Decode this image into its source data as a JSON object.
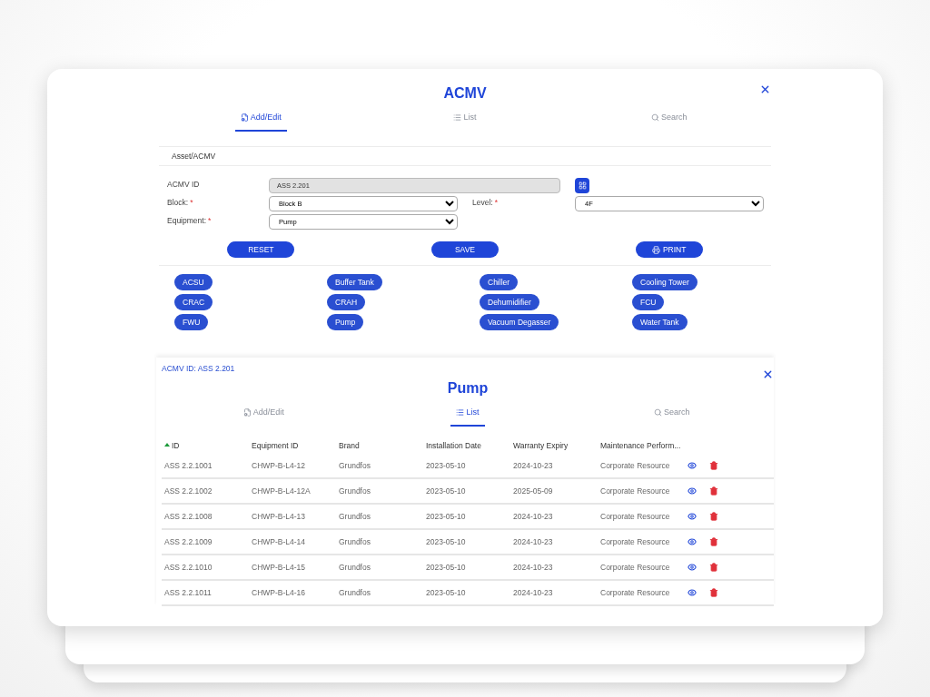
{
  "dialog": {
    "title": "ACMV",
    "tabs": [
      {
        "label": "Add/Edit",
        "kind": "add_edit",
        "selected": true
      },
      {
        "label": "List",
        "kind": "list",
        "selected": false
      },
      {
        "label": "Search",
        "kind": "search",
        "selected": false
      }
    ],
    "breadcrumb": "Asset/ACMV",
    "form": {
      "acmv_id": {
        "label": "ACMV ID",
        "value": "ASS 2.201",
        "disabled": true
      },
      "block": {
        "label": "Block:",
        "required_mark": "*",
        "value": "Block B"
      },
      "level": {
        "label": "Level:",
        "required_mark": "*",
        "value": "4F"
      },
      "equipment": {
        "label": "Equipment:",
        "required_mark": "*",
        "value": "Pump"
      }
    },
    "buttons": [
      {
        "label": "RESET",
        "kind": "plain"
      },
      {
        "label": "SAVE",
        "kind": "plain"
      },
      {
        "label": "PRINT",
        "kind": "print"
      }
    ],
    "equipment_types": [
      "ACSU",
      "Buffer Tank",
      "Chiller",
      "Cooling Tower",
      "CRAC",
      "CRAH",
      "Dehumidifier",
      "FCU",
      "FWU",
      "Pump",
      "Vacuum Degasser",
      "Water Tank"
    ]
  },
  "list_panel": {
    "context": "ACMV ID: ASS 2.201",
    "title": "Pump",
    "tabs": [
      {
        "label": "Add/Edit",
        "kind": "add_edit",
        "selected": false
      },
      {
        "label": "List",
        "kind": "list",
        "selected": true
      },
      {
        "label": "Search",
        "kind": "search",
        "selected": false
      }
    ],
    "table": {
      "columns": [
        {
          "label": "ID",
          "sorted": true
        },
        {
          "label": "Equipment ID",
          "sorted": false
        },
        {
          "label": "Brand",
          "sorted": false
        },
        {
          "label": "Installation Date",
          "sorted": false
        },
        {
          "label": "Warranty Expiry",
          "sorted": false
        },
        {
          "label": "Maintenance Perform...",
          "sorted": false
        }
      ],
      "rows": [
        [
          "ASS 2.2.1001",
          "CHWP-B-L4-12",
          "Grundfos",
          "2023-05-10",
          "2024-10-23",
          "Corporate Resource"
        ],
        [
          "ASS 2.2.1002",
          "CHWP-B-L4-12A",
          "Grundfos",
          "2023-05-10",
          "2025-05-09",
          "Corporate Resource"
        ],
        [
          "ASS 2.2.1008",
          "CHWP-B-L4-13",
          "Grundfos",
          "2023-05-10",
          "2024-10-23",
          "Corporate Resource"
        ],
        [
          "ASS 2.2.1009",
          "CHWP-B-L4-14",
          "Grundfos",
          "2023-05-10",
          "2024-10-23",
          "Corporate Resource"
        ],
        [
          "ASS 2.2.1010",
          "CHWP-B-L4-15",
          "Grundfos",
          "2023-05-10",
          "2024-10-23",
          "Corporate Resource"
        ],
        [
          "ASS 2.2.1011",
          "CHWP-B-L4-16",
          "Grundfos",
          "2023-05-10",
          "2024-10-23",
          "Corporate Resource"
        ]
      ]
    }
  }
}
